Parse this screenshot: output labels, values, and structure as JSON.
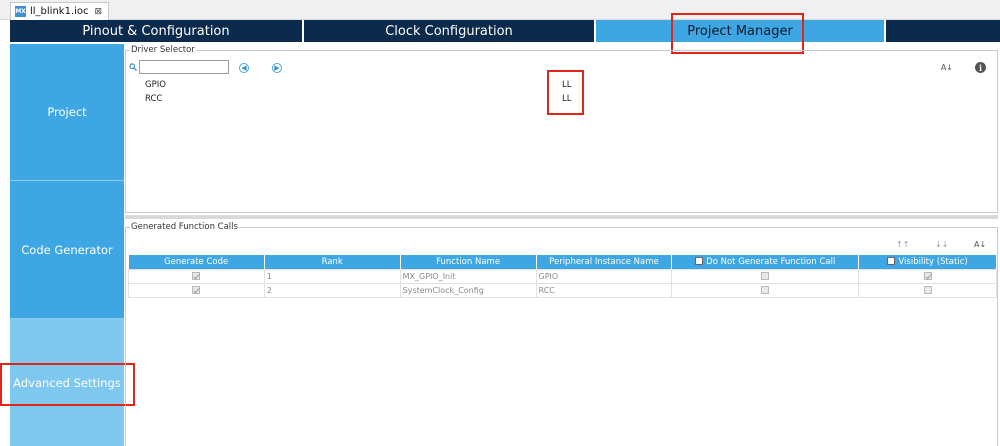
{
  "file_tab": {
    "icon": "MX",
    "title": "ll_blink1.ioc",
    "close": "⊠"
  },
  "main_tabs": [
    {
      "label": "Pinout & Configuration"
    },
    {
      "label": "Clock Configuration"
    },
    {
      "label": "Project Manager"
    },
    {
      "label": ""
    }
  ],
  "side_nav": {
    "project": "Project",
    "code_generator": "Code Generator",
    "advanced_settings": "Advanced Settings"
  },
  "driver_selector": {
    "title": "Driver Selector",
    "filter_value": "",
    "rows": [
      {
        "name": "GPIO",
        "driver": "LL"
      },
      {
        "name": "RCC",
        "driver": "LL"
      }
    ]
  },
  "generated_calls": {
    "title": "Generated Function Calls",
    "headers": {
      "generate_code": "Generate Code",
      "rank": "Rank",
      "function_name": "Function Name",
      "peripheral_instance": "Peripheral Instance Name",
      "do_not_generate": "Do Not Generate Function Call",
      "visibility": "Visibility (Static)"
    },
    "rows": [
      {
        "rank": "1",
        "function": "MX_GPIO_Init",
        "peripheral": "GPIO",
        "generate": true,
        "do_not_generate": false,
        "visibility": true
      },
      {
        "rank": "2",
        "function": "SystemClock_Config",
        "peripheral": "RCC",
        "generate": true,
        "do_not_generate": false,
        "visibility": false
      }
    ]
  },
  "colors": {
    "accent": "#3ea7e3",
    "header_dark": "#0b2a4c",
    "highlight": "#e0251b",
    "adv_settings_bg": "#7ec7ee"
  }
}
